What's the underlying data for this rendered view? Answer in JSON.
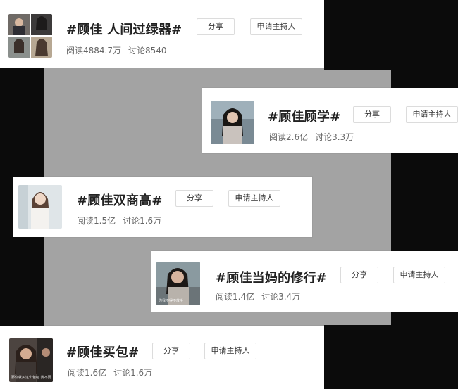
{
  "cards": [
    {
      "title": "#顾佳 人间过绿器#",
      "read": "阅读4884.7万",
      "discuss": "讨论8540",
      "share": "分享",
      "host": "申请主持人"
    },
    {
      "title": "#顾佳顾学#",
      "read": "阅读2.6亿",
      "discuss": "讨论3.3万",
      "share": "分享",
      "host": "申请主持人"
    },
    {
      "title": "#顾佳双商高#",
      "read": "阅读1.5亿",
      "discuss": "讨论1.6万",
      "share": "分享",
      "host": "申请主持人"
    },
    {
      "title": "#顾佳当妈的修行#",
      "read": "阅读1.4亿",
      "discuss": "讨论3.4万",
      "share": "分享",
      "host": "申请主持人",
      "caption": "你我不得不放手"
    },
    {
      "title": "#顾佳买包#",
      "read": "阅读1.6亿",
      "discuss": "讨论1.6万",
      "share": "分享",
      "host": "申请主持人",
      "caption": "那你就买这个包吧 我不要"
    }
  ]
}
